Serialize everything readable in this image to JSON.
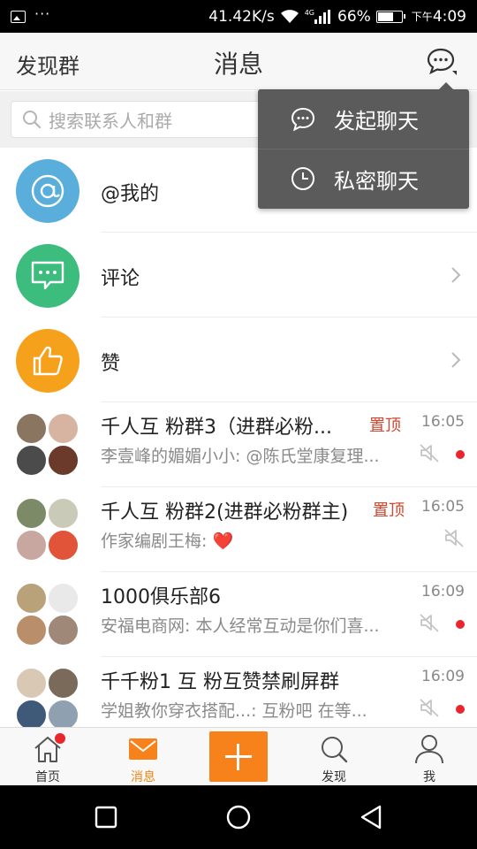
{
  "status_bar": {
    "speed": "41.42K/s",
    "battery_percent": "66%",
    "battery_level": 0.66,
    "time_prefix": "下午",
    "time": "4:09",
    "network_label": "4G"
  },
  "header": {
    "left_label": "发现群",
    "title": "消息"
  },
  "search": {
    "placeholder": "搜索联系人和群"
  },
  "popup": {
    "items": [
      {
        "label": "发起聊天",
        "icon": "chat-bubble-icon"
      },
      {
        "label": "私密聊天",
        "icon": "clock-icon"
      }
    ]
  },
  "categories": [
    {
      "label": "@我的",
      "icon": "at-icon",
      "color": "#5aaedb"
    },
    {
      "label": "评论",
      "icon": "comment-icon",
      "color": "#3dbd7d"
    },
    {
      "label": "赞",
      "icon": "thumbs-up-icon",
      "color": "#f6a11c"
    }
  ],
  "groups": [
    {
      "title": "千人互 粉群3（进群必粉...",
      "pinned": "置顶",
      "time": "16:05",
      "preview": "李壹峰的媚媚小小: @陈氏堂康复理...",
      "muted": true,
      "unread_dot": true
    },
    {
      "title": "千人互 粉群2(进群必粉群主)",
      "pinned": "置顶",
      "time": "16:05",
      "preview": "作家编剧王梅: ❤️",
      "muted": true,
      "unread_dot": false
    },
    {
      "title": "1000俱乐部6",
      "pinned": "",
      "time": "16:09",
      "preview": "安福电商网: 本人经常互动是你们喜...",
      "muted": true,
      "unread_dot": true
    },
    {
      "title": "千千粉1  互 粉互赞禁刷屏群",
      "pinned": "",
      "time": "16:09",
      "preview": "学姐教你穿衣搭配...: 互粉吧  在等...",
      "muted": true,
      "unread_dot": true
    }
  ],
  "tabbar": {
    "tabs": [
      {
        "label": "首页",
        "icon": "home-icon",
        "badge": true
      },
      {
        "label": "消息",
        "icon": "mail-icon",
        "active": true
      },
      {
        "label": "",
        "icon": "plus-icon"
      },
      {
        "label": "发现",
        "icon": "search-icon"
      },
      {
        "label": "我",
        "icon": "profile-icon"
      }
    ]
  },
  "colors": {
    "accent_orange": "#f7821b",
    "pin_red": "#d4452b",
    "unread_red": "#e8262b"
  }
}
